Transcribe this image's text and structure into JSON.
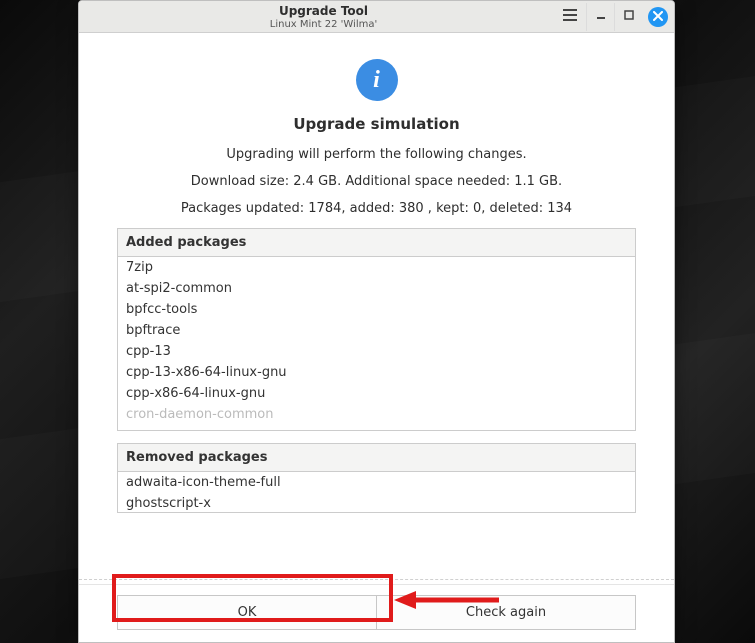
{
  "titlebar": {
    "app_title": "Upgrade Tool",
    "subtitle": "Linux Mint 22 'Wilma'"
  },
  "info_icon_glyph": "i",
  "heading": "Upgrade simulation",
  "line_changes": "Upgrading will perform the following changes.",
  "line_download": "Download size: 2.4 GB. Additional space needed: 1.1 GB.",
  "line_packages": "Packages updated: 1784, added: 380 , kept: 0, deleted: 134",
  "sections": {
    "added": {
      "header": "Added packages",
      "items": [
        "7zip",
        "at-spi2-common",
        "bpfcc-tools",
        "bpftrace",
        "cpp-13",
        "cpp-13-x86-64-linux-gnu",
        "cpp-x86-64-linux-gnu"
      ],
      "truncated_item": "cron-daemon-common"
    },
    "removed": {
      "header": "Removed packages",
      "items": [
        "adwaita-icon-theme-full",
        "ghostscript-x"
      ]
    }
  },
  "footer": {
    "ok_label": "OK",
    "check_again_label": "Check again"
  },
  "colors": {
    "accent": "#3b8de3",
    "annotation": "#e01b1b"
  }
}
